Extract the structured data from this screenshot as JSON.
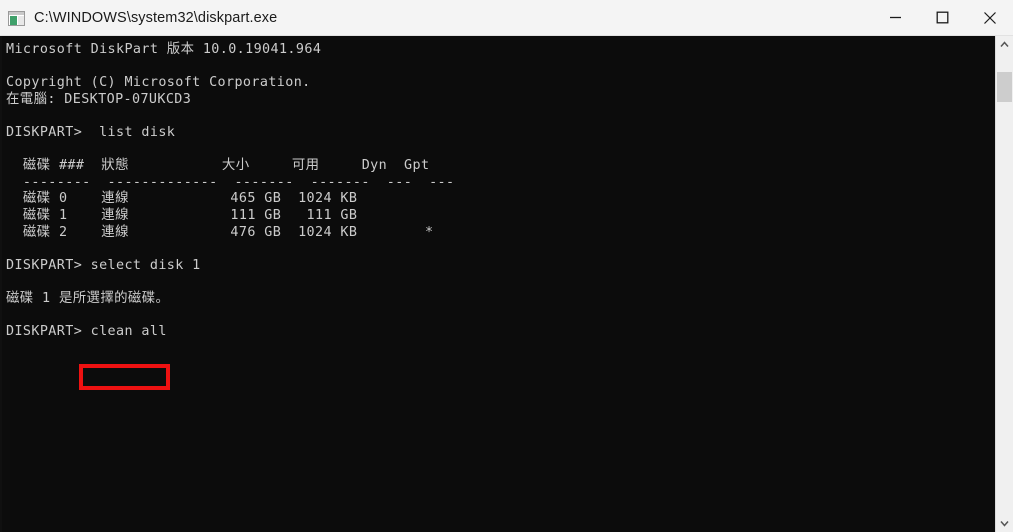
{
  "window": {
    "title": "C:\\WINDOWS\\system32\\diskpart.exe",
    "icon": "console-window-icon",
    "controls": {
      "minimize_label": "Minimize",
      "maximize_label": "Maximize",
      "close_label": "Close"
    }
  },
  "console": {
    "background_color": "#0c0c0c",
    "text_color": "#cccccc",
    "content": "Microsoft DiskPart 版本 10.0.19041.964\n\nCopyright (C) Microsoft Corporation.\n在電腦: DESKTOP-07UKCD3\n\nDISKPART>  list disk\n\n  磁碟 ###  狀態           大小     可用     Dyn  Gpt\n  --------  -------------  -------  -------  ---  ---\n  磁碟 0    連線            465 GB  1024 KB\n  磁碟 1    連線            111 GB   111 GB\n  磁碟 2    連線            476 GB  1024 KB        *\n\nDISKPART> select disk 1\n\n磁碟 1 是所選擇的磁碟。\n\nDISKPART> clean all",
    "lines": [
      "Microsoft DiskPart 版本 10.0.19041.964",
      "",
      "Copyright (C) Microsoft Corporation.",
      "在電腦: DESKTOP-07UKCD3",
      "",
      "DISKPART>  list disk",
      "",
      "  磁碟 ###  狀態           大小     可用     Dyn  Gpt",
      "  --------  -------------  -------  -------  ---  ---",
      "  磁碟 0    連線            465 GB  1024 KB",
      "  磁碟 1    連線            111 GB   111 GB",
      "  磁碟 2    連線            476 GB  1024 KB        *",
      "",
      "DISKPART> select disk 1",
      "",
      "磁碟 1 是所選擇的磁碟。",
      "",
      "DISKPART> clean all"
    ],
    "version_line": "Microsoft DiskPart 版本 10.0.19041.964",
    "copyright_line": "Copyright (C) Microsoft Corporation.",
    "computer_line": "在電腦: DESKTOP-07UKCD3",
    "prompt": "DISKPART>",
    "commands": [
      "list disk",
      "select disk 1",
      "clean all"
    ],
    "select_result": "磁碟 1 是所選擇的磁碟。",
    "disk_table": {
      "headers": [
        "磁碟 ###",
        "狀態",
        "大小",
        "可用",
        "Dyn",
        "Gpt"
      ],
      "separators": [
        "--------",
        "-------------",
        "-------",
        "-------",
        "---",
        "---"
      ],
      "rows": [
        {
          "disk": "磁碟 0",
          "status": "連線",
          "size": "465 GB",
          "free": "1024 KB",
          "dyn": "",
          "gpt": ""
        },
        {
          "disk": "磁碟 1",
          "status": "連線",
          "size": "111 GB",
          "free": "111 GB",
          "dyn": "",
          "gpt": ""
        },
        {
          "disk": "磁碟 2",
          "status": "連線",
          "size": "476 GB",
          "free": "1024 KB",
          "dyn": "",
          "gpt": "*"
        }
      ]
    }
  },
  "annotation": {
    "highlight_color": "#ee1111",
    "highlighted_text": "clean all"
  },
  "scrollbar": {
    "up_arrow": "chevron-up-icon",
    "down_arrow": "chevron-down-icon",
    "thumb_color": "#cdcdcd"
  }
}
